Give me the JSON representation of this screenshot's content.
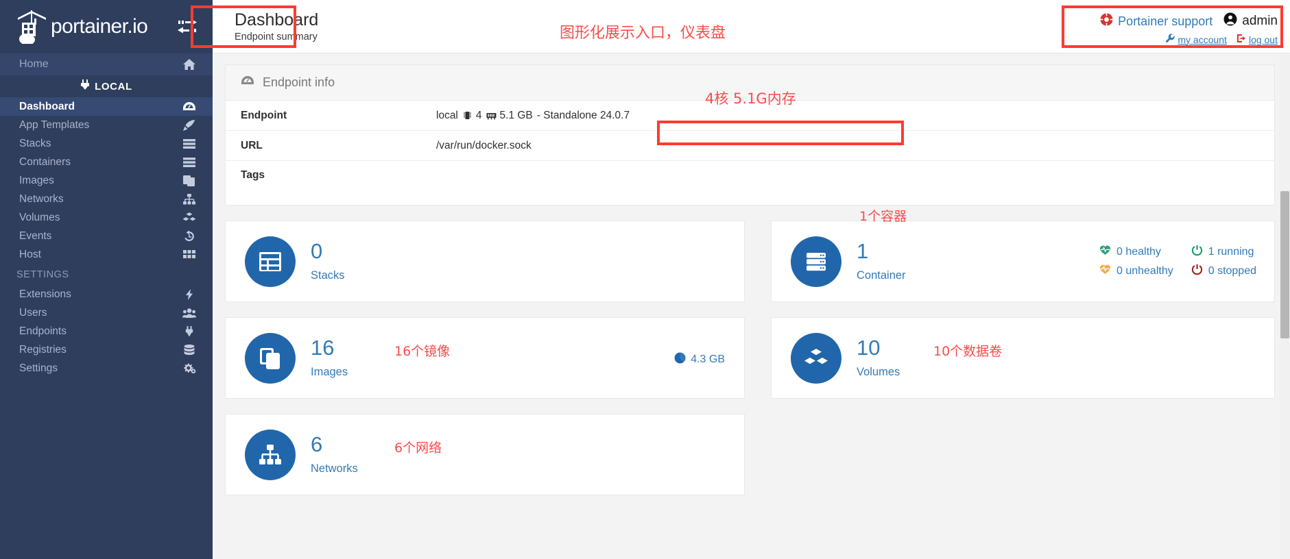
{
  "brand": {
    "name": "portainer.io",
    "toggle_icon": "collapse-arrows-icon"
  },
  "sidebar": {
    "home": {
      "label": "Home",
      "icon": "home-icon"
    },
    "section_local": {
      "label": "LOCAL",
      "icon": "plug-icon"
    },
    "items": [
      {
        "label": "Dashboard",
        "icon": "dashboard-icon",
        "active": true
      },
      {
        "label": "App Templates",
        "icon": "rocket-icon",
        "active": false
      },
      {
        "label": "Stacks",
        "icon": "stacks-icon",
        "active": false
      },
      {
        "label": "Containers",
        "icon": "containers-icon",
        "active": false
      },
      {
        "label": "Images",
        "icon": "images-icon",
        "active": false
      },
      {
        "label": "Networks",
        "icon": "networks-icon",
        "active": false
      },
      {
        "label": "Volumes",
        "icon": "volumes-icon",
        "active": false
      },
      {
        "label": "Events",
        "icon": "history-icon",
        "active": false
      },
      {
        "label": "Host",
        "icon": "host-icon",
        "active": false
      }
    ],
    "settings_header": "SETTINGS",
    "settings_items": [
      {
        "label": "Extensions",
        "icon": "bolt-icon"
      },
      {
        "label": "Users",
        "icon": "users-icon"
      },
      {
        "label": "Endpoints",
        "icon": "plug-icon"
      },
      {
        "label": "Registries",
        "icon": "database-icon"
      },
      {
        "label": "Settings",
        "icon": "gears-icon"
      }
    ]
  },
  "header": {
    "title": "Dashboard",
    "subtitle": "Endpoint summary",
    "annotation": "图形化展示入口，仪表盘",
    "support_label": "Portainer support",
    "support_icon": "lifebuoy-icon",
    "user_name": "admin",
    "user_icon": "user-circle-icon",
    "my_account_label": "my account",
    "my_account_icon": "wrench-icon",
    "logout_label": "log out",
    "logout_icon": "logout-icon"
  },
  "endpoint_info": {
    "panel_title": "Endpoint info",
    "panel_icon": "dashboard-icon",
    "annotation": "4核 5.1G内存",
    "rows": [
      {
        "key": "Endpoint",
        "value": "local",
        "cpu": "4",
        "memory": "5.1 GB",
        "suffix": "- Standalone 24.0.7"
      },
      {
        "key": "URL",
        "value": "/var/run/docker.sock"
      },
      {
        "key": "Tags",
        "value": ""
      }
    ],
    "cpu_icon": "cpu-icon",
    "memory_icon": "memory-icon"
  },
  "cards": {
    "stacks": {
      "count": "0",
      "label": "Stacks",
      "icon": "stacks-icon",
      "annotation": ""
    },
    "containers": {
      "count": "1",
      "label": "Container",
      "icon": "containers-icon",
      "annotation": "1个容器"
    },
    "images": {
      "count": "16",
      "label": "Images",
      "icon": "images-icon",
      "annotation": "16个镜像",
      "size": "4.3 GB",
      "size_icon": "pie-chart-icon"
    },
    "volumes": {
      "count": "10",
      "label": "Volumes",
      "icon": "volumes-icon",
      "annotation": "10个数据卷"
    },
    "networks": {
      "count": "6",
      "label": "Networks",
      "icon": "networks-icon",
      "annotation": "6个网络"
    }
  },
  "container_health": [
    {
      "label": "0 healthy",
      "icon": "heartbeat-green-icon",
      "color": "#2f9e7e"
    },
    {
      "label": "1 running",
      "icon": "power-green-icon",
      "color": "#1a9e6e"
    },
    {
      "label": "0 unhealthy",
      "icon": "heartbeat-orange-icon",
      "color": "#f0ad4e"
    },
    {
      "label": "0 stopped",
      "icon": "power-red-icon",
      "color": "#a32020"
    }
  ],
  "colors": {
    "sidebar_bg": "#2f3e5d",
    "sidebar_active": "#364a73",
    "accent_blue": "#337ab7",
    "icon_circle": "#2166ab",
    "annotation_red": "#fc4b4b",
    "redbox": "#fe3b30"
  }
}
